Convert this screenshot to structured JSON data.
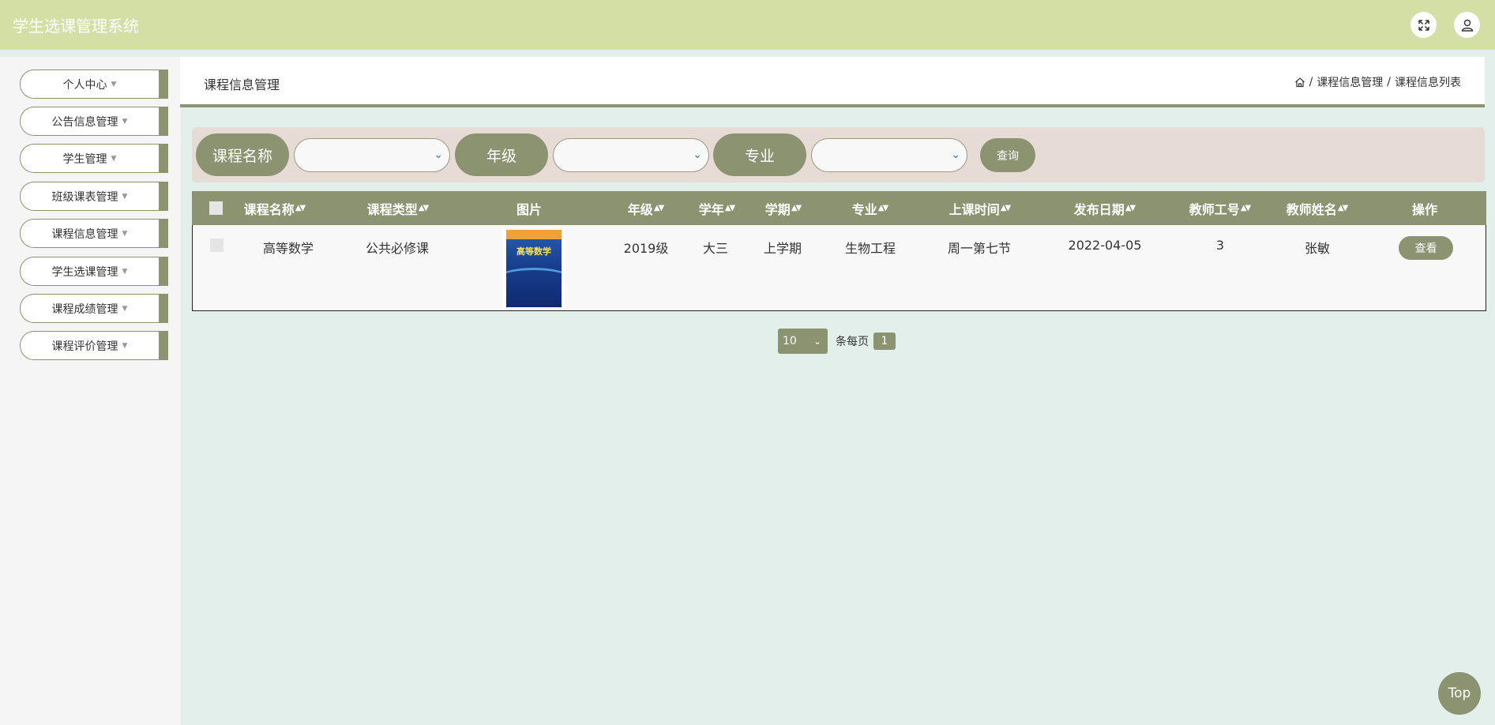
{
  "header": {
    "app_title": "学生选课管理系统",
    "icons": [
      "fullscreen-icon",
      "user-icon"
    ]
  },
  "sidebar": {
    "items": [
      {
        "label": "个人中心"
      },
      {
        "label": "公告信息管理"
      },
      {
        "label": "学生管理"
      },
      {
        "label": "班级课表管理"
      },
      {
        "label": "课程信息管理"
      },
      {
        "label": "学生选课管理"
      },
      {
        "label": "课程成绩管理"
      },
      {
        "label": "课程评价管理"
      }
    ]
  },
  "page": {
    "section_title": "课程信息管理",
    "breadcrumb": {
      "home_icon": "home-icon",
      "separator": "/",
      "level1": "课程信息管理",
      "level2": "课程信息列表"
    }
  },
  "search": {
    "course_name_label": "课程名称",
    "course_name_value": "",
    "grade_label": "年级",
    "grade_value": "",
    "major_label": "专业",
    "major_value": "",
    "query_button": "查询"
  },
  "table": {
    "headers": {
      "course_name": "课程名称",
      "course_type": "课程类型",
      "image": "图片",
      "grade": "年级",
      "school_year": "学年",
      "semester": "学期",
      "major": "专业",
      "class_time": "上课时间",
      "publish_date": "发布日期",
      "teacher_id": "教师工号",
      "teacher_name": "教师姓名",
      "action": "操作"
    },
    "rows": [
      {
        "course_name": "高等数学",
        "course_type": "公共必修课",
        "image_title": "高等数学",
        "grade": "2019级",
        "school_year": "大三",
        "semester": "上学期",
        "major": "生物工程",
        "class_time": "周一第七节",
        "publish_date": "2022-04-05",
        "teacher_id": "3",
        "teacher_name": "张敏",
        "view_button": "查看"
      }
    ]
  },
  "pagination": {
    "page_size": "10",
    "per_page_label": "条每页",
    "current_page": "1"
  },
  "top_button": "Top"
}
